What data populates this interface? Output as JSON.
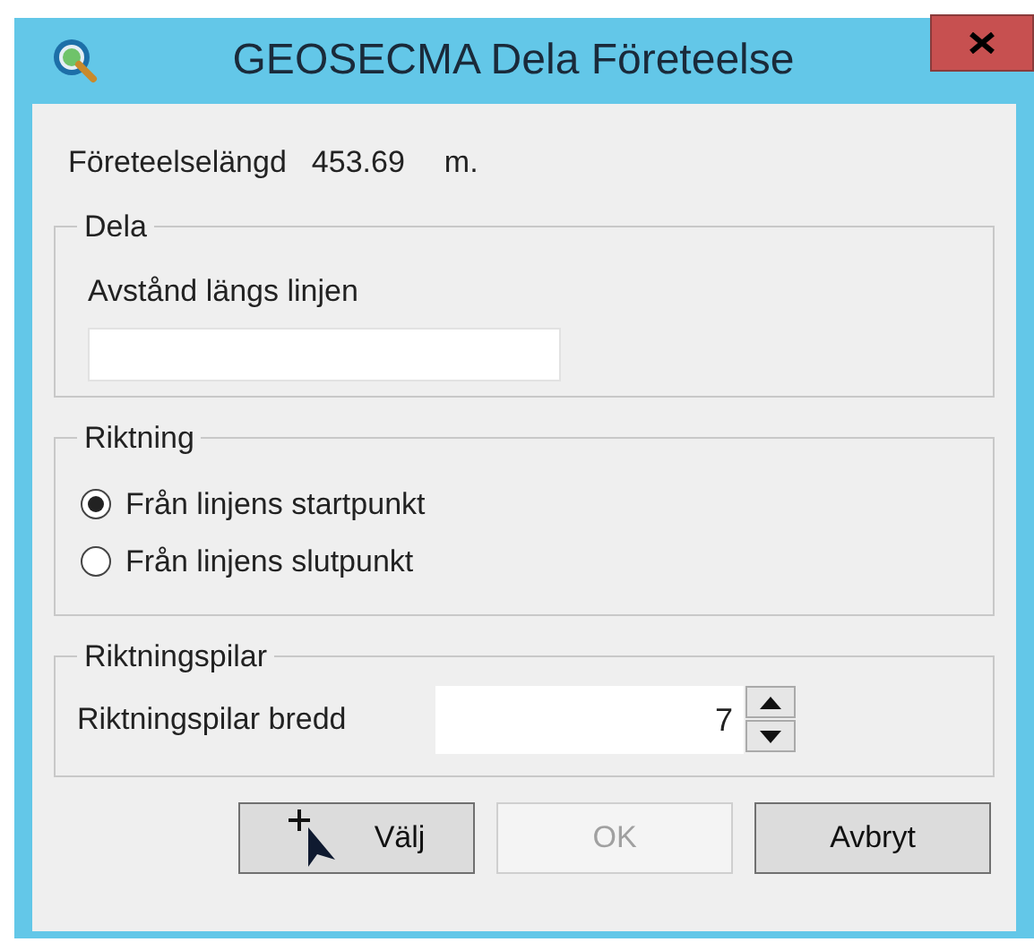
{
  "window": {
    "title": "GEOSECMA Dela Företeelse"
  },
  "length": {
    "label": "Företeelselängd",
    "value": "453.69",
    "unit": "m."
  },
  "split": {
    "title": "Dela",
    "field_label": "Avstånd längs linjen"
  },
  "direction": {
    "title": "Riktning",
    "options": [
      {
        "label": "Från linjens startpunkt",
        "selected": true
      },
      {
        "label": "Från linjens slutpunkt",
        "selected": false
      }
    ]
  },
  "arrows": {
    "title": "Riktningspilar",
    "label": "Riktningspilar bredd",
    "value": "7"
  },
  "buttons": [
    {
      "label": "Välj",
      "kind": "pick",
      "disabled": false
    },
    {
      "label": "OK",
      "kind": "plain",
      "disabled": true
    },
    {
      "label": "Avbryt",
      "kind": "plain",
      "disabled": false
    }
  ]
}
